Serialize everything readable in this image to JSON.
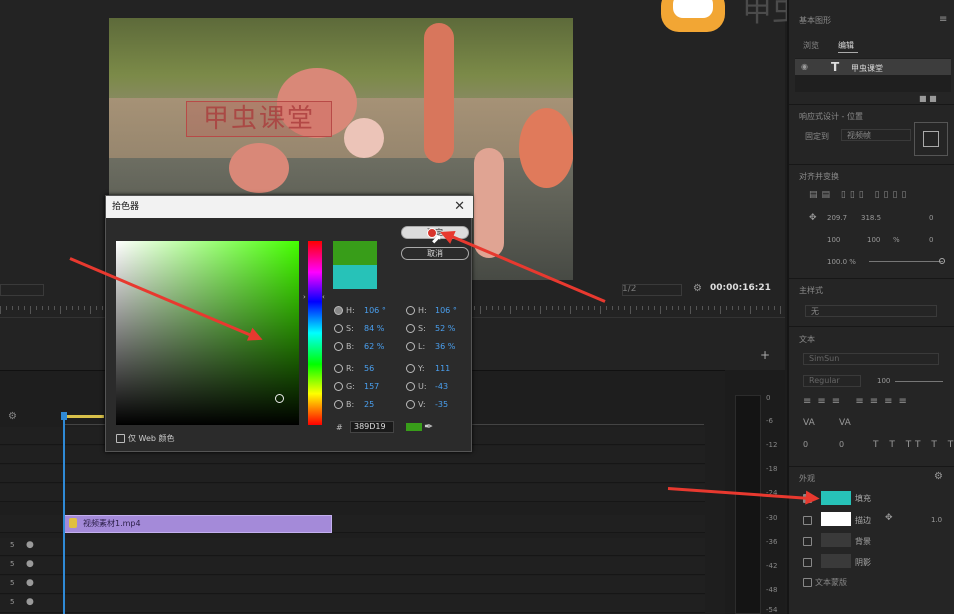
{
  "program_monitor": {
    "video_overlay_title": "甲虫课堂",
    "timecode": "00:00:16:21",
    "fit_label": "1/2"
  },
  "watermark": {
    "text": "甲虫课堂"
  },
  "timeline": {
    "clip_label": "视频素材1.mp4",
    "track_labels": [
      "5",
      "5",
      "5",
      "5"
    ],
    "meter_scale": [
      "0",
      "-6",
      "-12",
      "-18",
      "-24",
      "-30",
      "-36",
      "-42",
      "-48",
      "-54"
    ]
  },
  "essential_graphics": {
    "title": "基本图形",
    "tabs": [
      "浏览",
      "编辑"
    ],
    "layer_name": "甲虫课堂",
    "responsive_design_label": "响应式设计 - 位置",
    "pin_to_label": "固定到",
    "pin_to_value": "视频帧",
    "align_transform_label": "对齐并变换",
    "pos_x": "209.7",
    "pos_y": "318.5",
    "rotation": "0",
    "scale_w": "100",
    "scale_h": "100",
    "scale_unit": "%",
    "anchor_rotation": "0",
    "opacity": "100.0 %",
    "master_style_label": "主样式",
    "master_style_value": "无",
    "text_section_label": "文本",
    "font_name": "SimSun",
    "font_style": "Regular",
    "font_size": "100",
    "tracking_values": [
      "0",
      "0",
      "0",
      "0"
    ],
    "appearance_label": "外观",
    "fill_label": "填充",
    "stroke_label": "描边",
    "stroke_width": "1.0",
    "background_label": "背景",
    "shadow_label": "阴影",
    "text_mask_label": "文本蒙版",
    "colors": {
      "fill": "#27c2b8",
      "stroke": "#ffffff"
    }
  },
  "color_picker": {
    "title": "拾色器",
    "ok_label": "确定",
    "cancel_label": "取消",
    "web_only_label": "仅 Web 颜色",
    "hsb": [
      {
        "label": "H:",
        "value": "106 °",
        "selected": true
      },
      {
        "label": "S:",
        "value": "84 %"
      },
      {
        "label": "B:",
        "value": "62 %"
      }
    ],
    "rgb": [
      {
        "label": "R:",
        "value": "56"
      },
      {
        "label": "G:",
        "value": "157"
      },
      {
        "label": "B:",
        "value": "25"
      }
    ],
    "hsl": [
      {
        "label": "H:",
        "value": "106 °"
      },
      {
        "label": "S:",
        "value": "52 %"
      },
      {
        "label": "L:",
        "value": "36 %"
      }
    ],
    "yuv": [
      {
        "label": "Y:",
        "value": "111"
      },
      {
        "label": "U:",
        "value": "-43"
      },
      {
        "label": "V:",
        "value": "-35"
      }
    ],
    "hex_label": "#",
    "hex_value": "389D19",
    "new_color": "#389d19",
    "old_color": "#27c2b8"
  }
}
